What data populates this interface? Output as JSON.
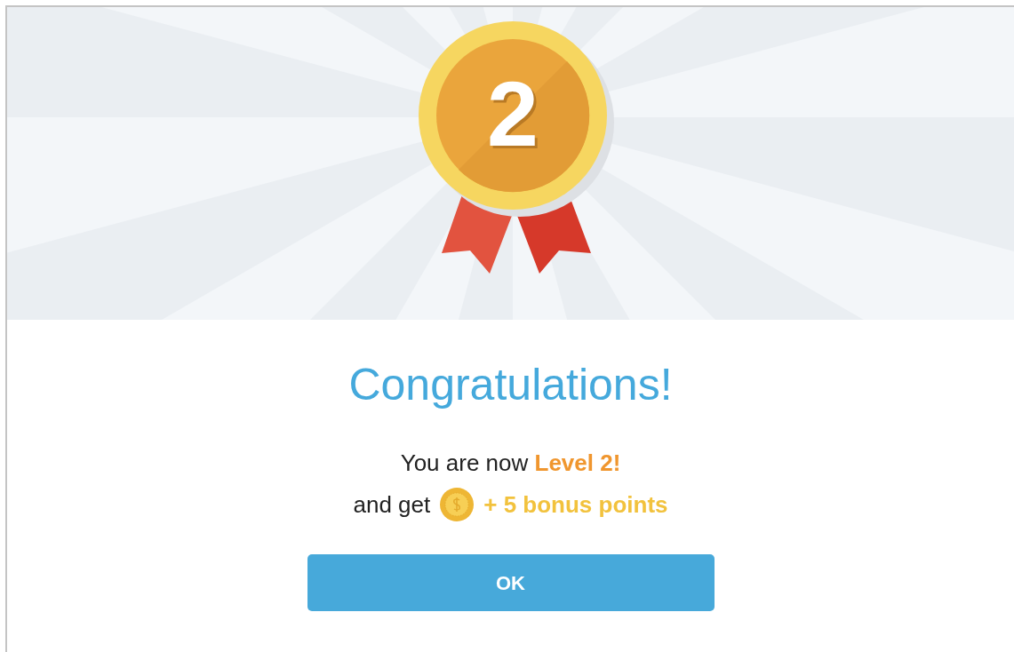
{
  "medal": {
    "number": "2"
  },
  "title": "Congratulations!",
  "message": "You are now **Level 2!**",
  "reward": {
    "prefix": "and get",
    "points": "+ 5 bonus points"
  },
  "button": "OK"
}
